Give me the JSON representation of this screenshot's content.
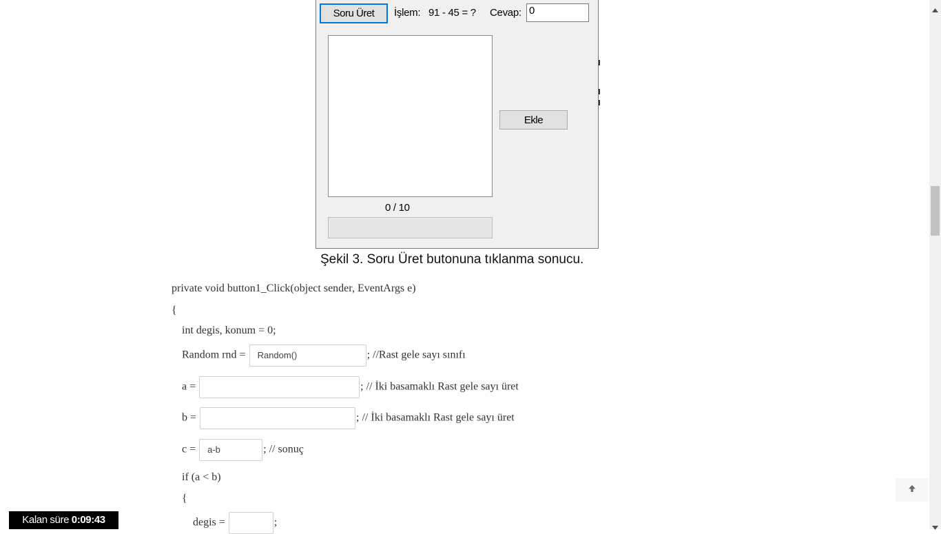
{
  "figure": {
    "generate_button": "Soru Üret",
    "operation_label": "İşlem:",
    "operation_value": "91 - 45 = ?",
    "answer_label": "Cevap:",
    "answer_value": "0",
    "add_button": "Ekle",
    "progress_text": "0 / 10",
    "progress_fraction": 0
  },
  "caption": "Şekil 3. Soru Üret butonuna tıklanma sonucu.",
  "code": {
    "line1": "private void button1_Click(object sender, EventArgs e)",
    "line2": "{",
    "line3": "int degis, konum = 0;",
    "line4_prefix": "Random rnd =",
    "line4_value": "Random()",
    "line4_suffix": "; //Rast gele sayı sınıfı",
    "line5_prefix": "a =",
    "line5_value": "",
    "line5_suffix": "; // İki basamaklı Rast gele sayı üret",
    "line6_prefix": "b =",
    "line6_value": "",
    "line6_suffix": "; // İki basamaklı Rast gele sayı üret",
    "line7_prefix": "c =",
    "line7_value": "a-b",
    "line7_suffix": "; // sonuç",
    "line8": "if (a < b)",
    "line9": "{",
    "line10_prefix": "degis =",
    "line10_value": "",
    "line10_suffix": ";"
  },
  "timer": {
    "label": "Kalan süre",
    "value": "0:09:43"
  },
  "icons": {
    "back_to_top": "arrow-up-icon"
  }
}
